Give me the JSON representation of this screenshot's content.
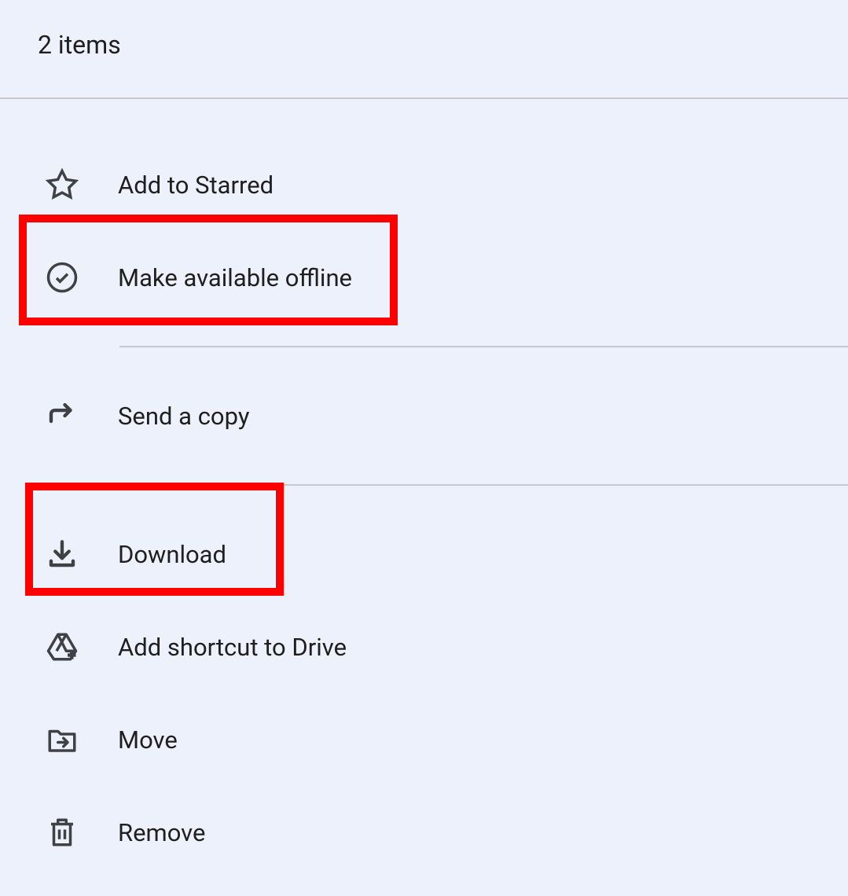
{
  "header": {
    "title": "2 items"
  },
  "menu": {
    "items": [
      {
        "label": "Add to Starred"
      },
      {
        "label": "Make available offline"
      },
      {
        "label": "Send a copy"
      },
      {
        "label": "Download"
      },
      {
        "label": "Add shortcut to Drive"
      },
      {
        "label": "Move"
      },
      {
        "label": "Remove"
      }
    ]
  }
}
